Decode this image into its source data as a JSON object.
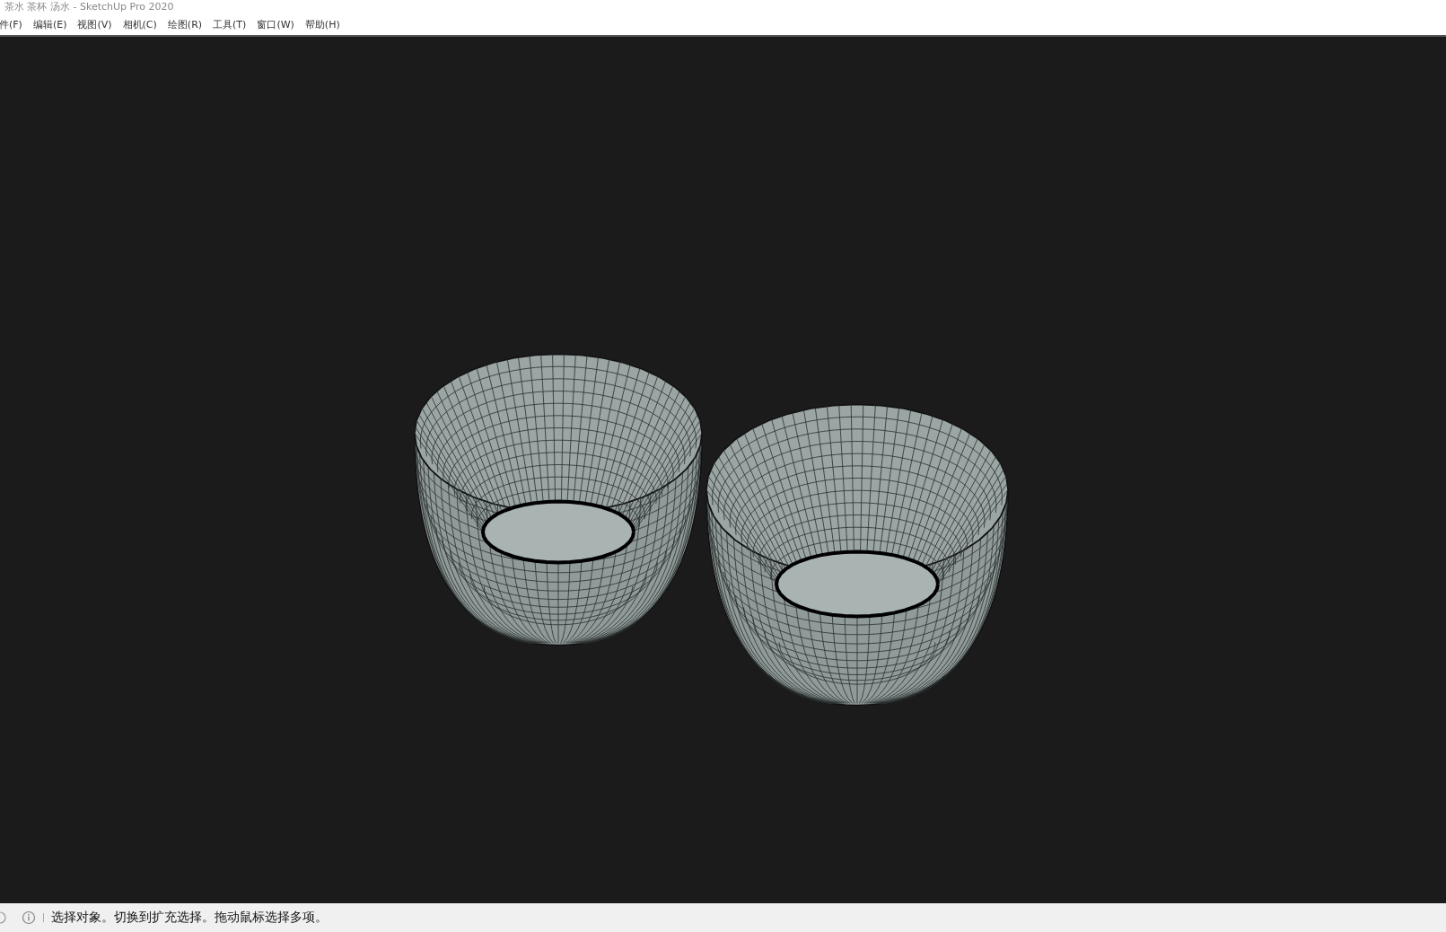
{
  "window": {
    "title": "茶水 茶杯 汤水 - SketchUp Pro 2020"
  },
  "menu": [
    "件(F)",
    "编辑(E)",
    "视图(V)",
    "相机(C)",
    "绘图(R)",
    "工具(T)",
    "窗口(W)",
    "帮助(H)"
  ],
  "status_bar": {
    "message": "选择对象。切换到扩充选择。拖动鼠标选择多项。"
  }
}
